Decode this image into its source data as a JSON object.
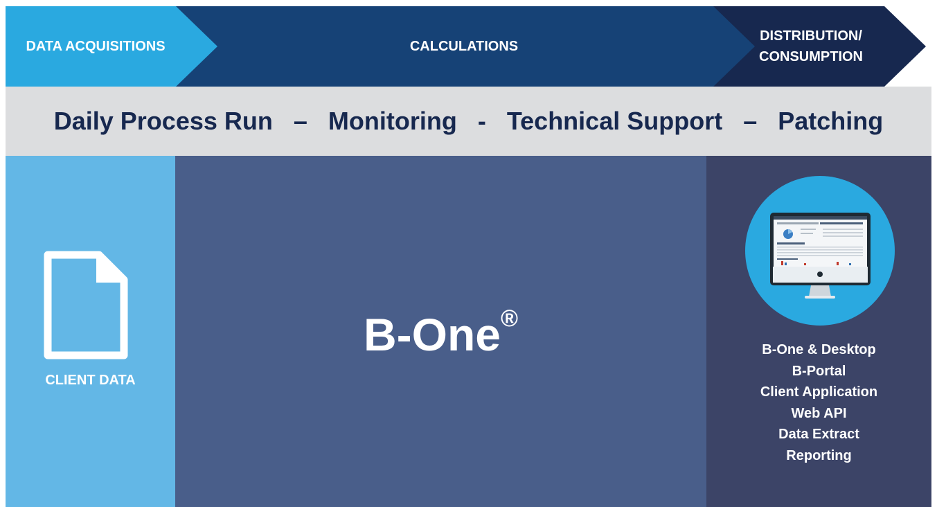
{
  "stages": {
    "acquisitions": "DATA ACQUISITIONS",
    "calculations": "CALCULATIONS",
    "distribution_line1": "DISTRIBUTION/",
    "distribution_line2": "CONSUMPTION"
  },
  "banner": "Daily Process Run   –   Monitoring   -   Technical Support   –   Patching",
  "client": {
    "label": "CLIENT DATA",
    "icon": "document-icon"
  },
  "core": {
    "title": "B-One",
    "mark": "®"
  },
  "distribution": {
    "icon": "desktop-monitor-icon",
    "outputs": [
      "B-One & Desktop",
      "B-Portal",
      "Client Application",
      "Web API",
      "Data Extract",
      "Reporting"
    ]
  },
  "colors": {
    "acquisitions": "#2aa9e0",
    "calculations": "#164276",
    "distribution": "#17284f",
    "banner_bg": "#dcdddf",
    "banner_text": "#17284f",
    "client_column": "#63b7e6",
    "core_column": "#495e8a",
    "distribution_column": "#3c4467"
  }
}
